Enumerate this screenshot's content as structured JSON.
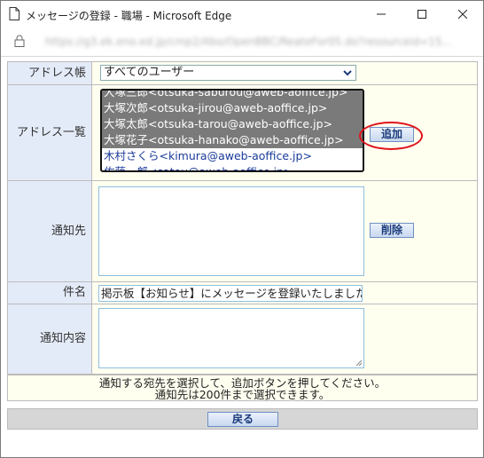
{
  "window": {
    "title": "メッセージの登録 - 職場 - Microsoft Edge",
    "url": "https://g3.ek.eno.ed.jp/cmp2/Abo/OpenBBC/ReateFor05.do?resourceid=15..."
  },
  "form": {
    "address_book": {
      "label": "アドレス帳",
      "selected": "すべてのユーザー"
    },
    "address_list": {
      "label": "アドレス一覧",
      "items": [
        {
          "text": "大塚三郎<otsuka-saburou@aweb-aoffice.jp>",
          "selected": true
        },
        {
          "text": "大塚次郎<otsuka-jirou@aweb-aoffice.jp>",
          "selected": true
        },
        {
          "text": "大塚太郎<otsuka-tarou@aweb-aoffice.jp>",
          "selected": true
        },
        {
          "text": "大塚花子<otsuka-hanako@aweb-aoffice.jp>",
          "selected": true
        },
        {
          "text": "木村さくら<kimura@aweb-aoffice.jp>",
          "selected": false
        },
        {
          "text": "佐藤一郎<satou@aweb-aoffice.jp>",
          "selected": false
        }
      ],
      "add_button": "追加"
    },
    "recipients": {
      "label": "通知先",
      "delete_button": "削除"
    },
    "subject": {
      "label": "件名",
      "value": "掲示板【お知らせ】にメッセージを登録いたしました。"
    },
    "body": {
      "label": "通知内容",
      "value": ""
    },
    "note_line1": "通知する宛先を選択して、追加ボタンを押してください。",
    "note_line2": "通知先は200件まで選択できます。",
    "back_button": "戻る"
  },
  "colors": {
    "label_bg": "#e4ebf8",
    "cell_bg": "#fffff0",
    "highlight": "#e0141b"
  }
}
